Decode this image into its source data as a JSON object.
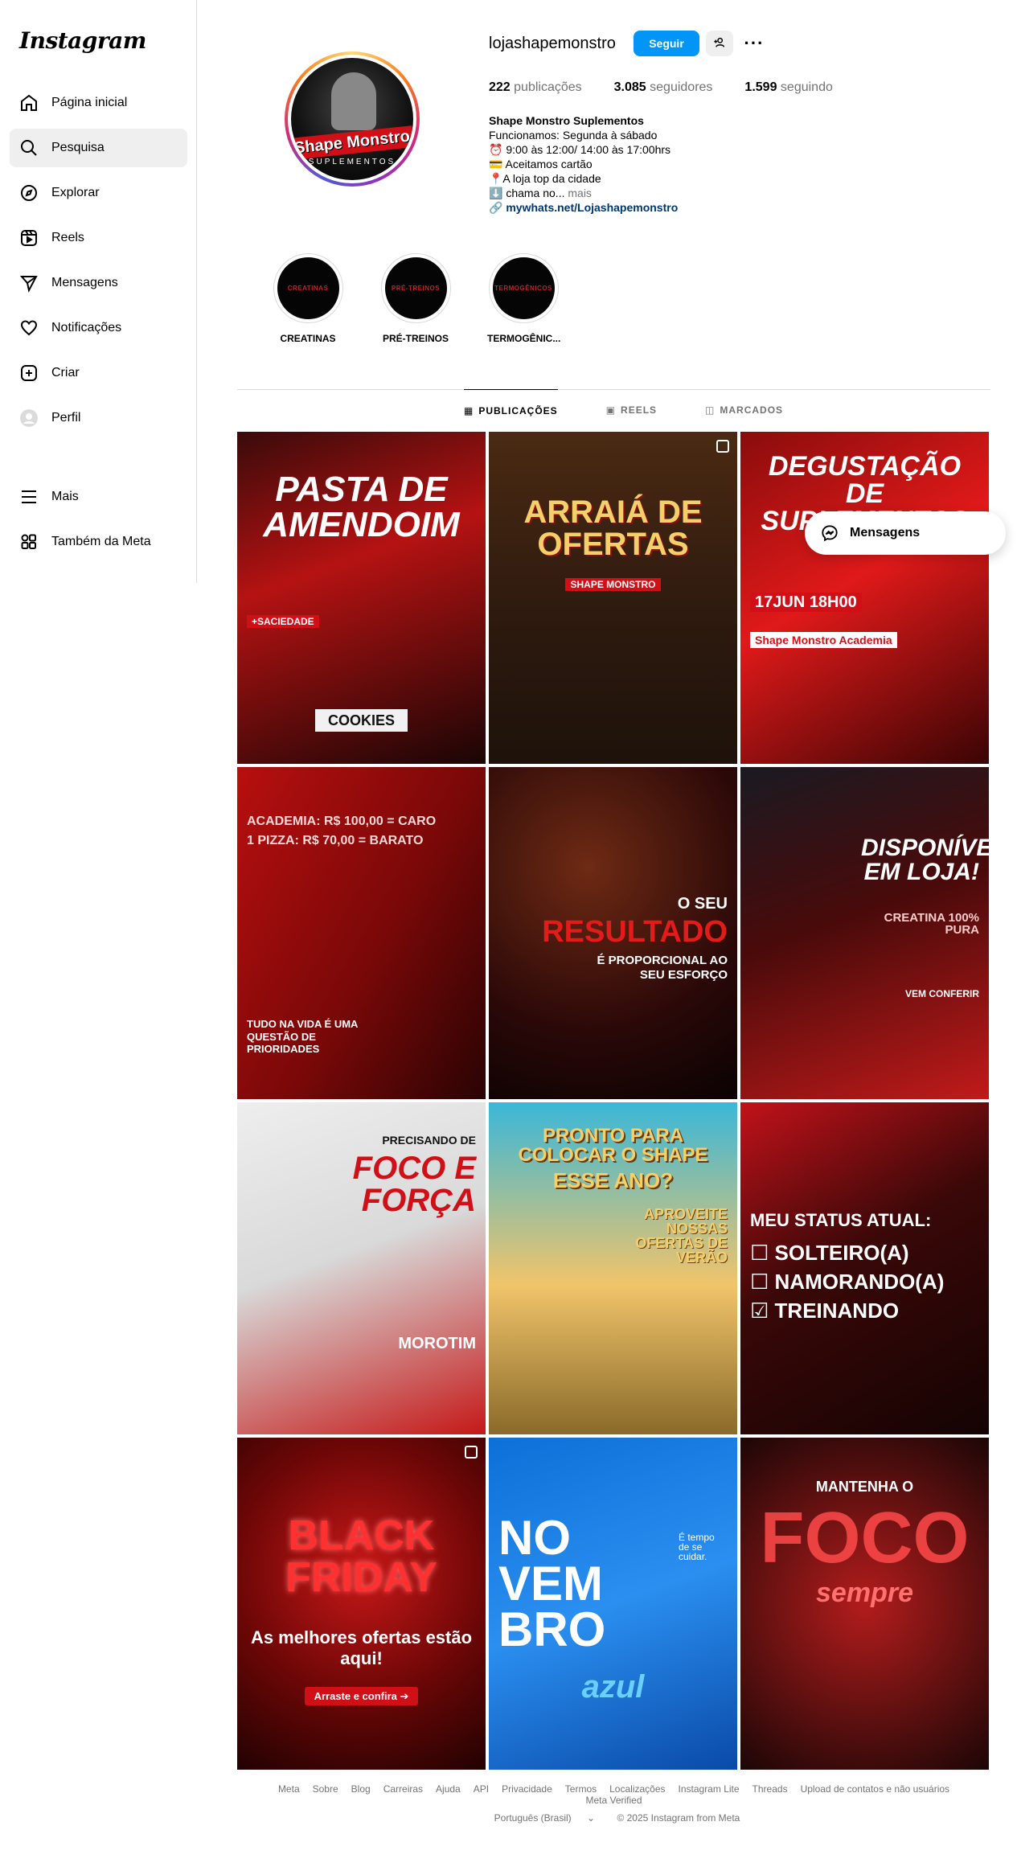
{
  "sidebar": {
    "logo": "Instagram",
    "items": [
      {
        "label": "Página inicial",
        "icon": "home-icon"
      },
      {
        "label": "Pesquisa",
        "icon": "search-icon"
      },
      {
        "label": "Explorar",
        "icon": "compass-icon"
      },
      {
        "label": "Reels",
        "icon": "reels-icon"
      },
      {
        "label": "Mensagens",
        "icon": "send-icon"
      },
      {
        "label": "Notificações",
        "icon": "heart-icon"
      },
      {
        "label": "Criar",
        "icon": "plus-icon"
      },
      {
        "label": "Perfil",
        "icon": "profile-avatar-icon"
      }
    ],
    "bottom": [
      {
        "label": "Mais",
        "icon": "menu-icon"
      },
      {
        "label": "Também da Meta",
        "icon": "meta-apps-icon"
      }
    ]
  },
  "profile": {
    "username": "lojashapemonstro",
    "follow_label": "Seguir",
    "avatar_brand": "Shape Monstro",
    "avatar_sub": "SUPLEMENTOS",
    "stats": {
      "posts_count": "222",
      "posts_label": " publicações",
      "followers_count": "3.085",
      "followers_label": " seguidores",
      "following_count": "1.599",
      "following_label": " seguindo"
    },
    "bio": {
      "name": "Shape Monstro Suplementos",
      "line1": "Funcionamos: Segunda à sábado",
      "line2": "⏰ 9:00 às 12:00/ 14:00 às 17:00hrs",
      "line3": "💳 Aceitamos cartão",
      "line4": "📍A loja top da cidade",
      "line5": "⬇️ chama no...",
      "more": "mais",
      "link": "mywhats.net/Lojashapemonstro"
    }
  },
  "highlights": [
    {
      "label": "CREATINAS",
      "inner": "CREATINAS"
    },
    {
      "label": "PRÉ-TREINOS",
      "inner": "PRÉ-TREINOS"
    },
    {
      "label": "TERMOGÊNIC...",
      "inner": "TERMOGÊNICOS"
    }
  ],
  "tabs": [
    {
      "label": "PUBLICAÇÕES",
      "icon": "grid-icon"
    },
    {
      "label": "REELS",
      "icon": "reels-icon"
    },
    {
      "label": "MARCADOS",
      "icon": "tagged-icon"
    }
  ],
  "posts": [
    {
      "title": "PASTA DE AMENDOIM",
      "sub": "+SACIEDADE",
      "extra": "COOKIES"
    },
    {
      "title": "ARRAIÁ DE OFERTAS",
      "sub": "SHAPE MONSTRO"
    },
    {
      "title": "DEGUSTAÇÃO DE SUPLEMENTOS",
      "sub": "17JUN 18H00",
      "extra": "Shape Monstro Academia"
    },
    {
      "title": "ACADEMIA: R$ 100,00 = CARO",
      "sub": "1 PIZZA: R$ 70,00 = BARATO",
      "extra": "TUDO NA VIDA É UMA QUESTÃO DE PRIORIDADES"
    },
    {
      "title": "RESULTADO",
      "sub": "O SEU",
      "extra": "É PROPORCIONAL AO SEU ESFORÇO"
    },
    {
      "title": "DISPONÍVEL EM LOJA!",
      "sub": "CREATINA 100% PURA",
      "extra": "VEM CONFERIR"
    },
    {
      "title": "FOCO E FORÇA",
      "sub": "PRECISANDO DE",
      "extra": "MOROTIM"
    },
    {
      "title": "PRONTO PARA COLOCAR O SHAPE",
      "sub": "ESSE ANO?",
      "extra": "APROVEITE NOSSAS OFERTAS DE VERÃO"
    },
    {
      "title": "MEU STATUS ATUAL:",
      "sub": "☐ SOLTEIRO(A)",
      "extra": "☐ NAMORANDO(A)",
      "extra2": "☑ TREINANDO"
    },
    {
      "title": "BLACK FRIDAY",
      "sub": "As melhores ofertas estão aqui!",
      "extra": "Arraste e confira ➔"
    },
    {
      "title": "NO VEM BRO",
      "sub": "azul",
      "extra": "É tempo de se cuidar."
    },
    {
      "title": "FOCO",
      "sub": "MANTENHA O",
      "extra": "sempre"
    }
  ],
  "messages_label": "Mensagens",
  "footer": {
    "links": [
      "Meta",
      "Sobre",
      "Blog",
      "Carreiras",
      "Ajuda",
      "API",
      "Privacidade",
      "Termos",
      "Localizações",
      "Instagram Lite",
      "Threads",
      "Upload de contatos e não usuários",
      "Meta Verified"
    ],
    "language": "Português (Brasil)",
    "copyright": "© 2025 Instagram from Meta"
  },
  "colors": {
    "accent": "#0095f6",
    "brand_red": "#d10f16"
  }
}
